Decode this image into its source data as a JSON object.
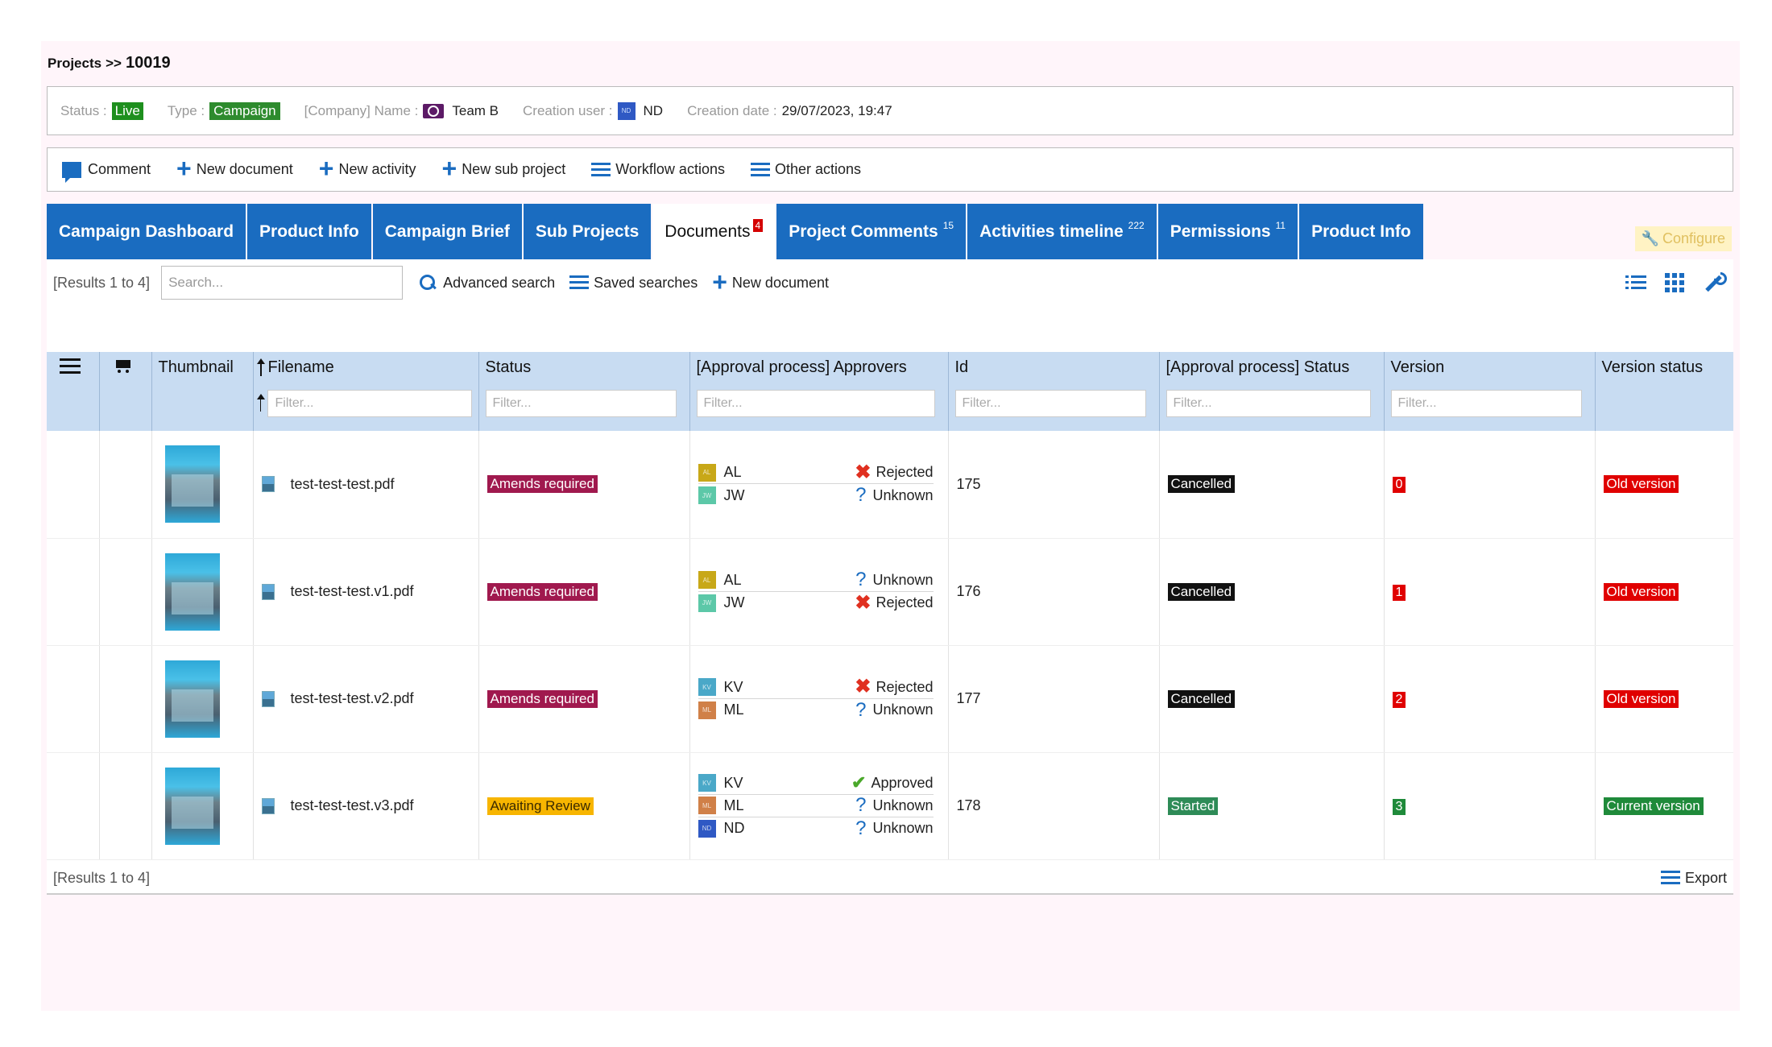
{
  "breadcrumb": {
    "root": "Projects",
    "sep": ">>",
    "id": "10019"
  },
  "info": {
    "status_label": "Status :",
    "status_value": "Live",
    "type_label": "Type :",
    "type_value": "Campaign",
    "company_label": "[Company] Name :",
    "company_value": "Team B",
    "user_label": "Creation user :",
    "user_initials": "ND",
    "user_value": "ND",
    "date_label": "Creation date :",
    "date_value": "29/07/2023, 19:47"
  },
  "toolbar": {
    "comment": "Comment",
    "new_document": "New document",
    "new_activity": "New activity",
    "new_sub_project": "New sub project",
    "workflow_actions": "Workflow actions",
    "other_actions": "Other actions"
  },
  "tabs": [
    {
      "label": "Campaign Dashboard",
      "count": ""
    },
    {
      "label": "Product Info",
      "count": ""
    },
    {
      "label": "Campaign Brief",
      "count": ""
    },
    {
      "label": "Sub Projects",
      "count": ""
    },
    {
      "label": "Documents",
      "count": "4"
    },
    {
      "label": "Project Comments",
      "count": "15"
    },
    {
      "label": "Activities timeline",
      "count": "222"
    },
    {
      "label": "Permissions",
      "count": "11"
    },
    {
      "label": "Product Info",
      "count": ""
    }
  ],
  "configure_label": "Configure",
  "search": {
    "results": "[Results 1 to 4]",
    "placeholder": "Search...",
    "advanced": "Advanced search",
    "saved": "Saved searches",
    "new_document": "New document"
  },
  "columns": {
    "thumbnail": "Thumbnail",
    "filename": "Filename",
    "status": "Status",
    "approvers": "[Approval process] Approvers",
    "id": "Id",
    "approval_status": "[Approval process] Status",
    "version": "Version",
    "version_status": "Version status",
    "filter_placeholder": "Filter..."
  },
  "rows": [
    {
      "filename": "test-test-test.pdf",
      "status": "Amends required",
      "approvers": [
        {
          "initials": "AL",
          "name": "AL",
          "color": "#c8a818",
          "state": "Rejected"
        },
        {
          "initials": "JW",
          "name": "JW",
          "color": "#5cc8a8",
          "state": "Unknown"
        }
      ],
      "id": "175",
      "approval_status": "Cancelled",
      "version": "0",
      "version_status": "Old version"
    },
    {
      "filename": "test-test-test.v1.pdf",
      "status": "Amends required",
      "approvers": [
        {
          "initials": "AL",
          "name": "AL",
          "color": "#c8a818",
          "state": "Unknown"
        },
        {
          "initials": "JW",
          "name": "JW",
          "color": "#5cc8a8",
          "state": "Rejected"
        }
      ],
      "id": "176",
      "approval_status": "Cancelled",
      "version": "1",
      "version_status": "Old version"
    },
    {
      "filename": "test-test-test.v2.pdf",
      "status": "Amends required",
      "approvers": [
        {
          "initials": "KV",
          "name": "KV",
          "color": "#4aa8c8",
          "state": "Rejected"
        },
        {
          "initials": "ML",
          "name": "ML",
          "color": "#d08048",
          "state": "Unknown"
        }
      ],
      "id": "177",
      "approval_status": "Cancelled",
      "version": "2",
      "version_status": "Old version"
    },
    {
      "filename": "test-test-test.v3.pdf",
      "status": "Awaiting Review",
      "approvers": [
        {
          "initials": "KV",
          "name": "KV",
          "color": "#4aa8c8",
          "state": "Approved"
        },
        {
          "initials": "ML",
          "name": "ML",
          "color": "#d08048",
          "state": "Unknown"
        },
        {
          "initials": "ND",
          "name": "ND",
          "color": "#2f59c4",
          "state": "Unknown"
        }
      ],
      "id": "178",
      "approval_status": "Started",
      "version": "3",
      "version_status": "Current version"
    }
  ],
  "footer": {
    "results": "[Results 1 to 4]",
    "export": "Export"
  }
}
